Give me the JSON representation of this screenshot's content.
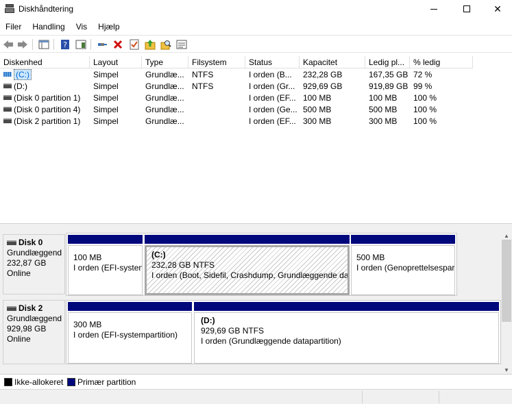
{
  "window": {
    "title": "Diskhåndtering"
  },
  "menu": [
    "Filer",
    "Handling",
    "Vis",
    "Hjælp"
  ],
  "toolbar": [
    "back-icon",
    "forward-icon",
    "console-tree-icon",
    "help-icon",
    "properties-list-icon",
    "connect-icon",
    "delete-icon",
    "checklist-icon",
    "folder-up-icon",
    "folder-search-icon",
    "console-view-icon"
  ],
  "table": {
    "columns": [
      "Diskenhed",
      "Layout",
      "Type",
      "Filsystem",
      "Status",
      "Kapacitet",
      "Ledig pl...",
      "% ledig"
    ],
    "rows": [
      [
        "(C:)",
        "Simpel",
        "Grundlæ...",
        "NTFS",
        "I orden (B...",
        "232,28 GB",
        "167,35 GB",
        "72 %"
      ],
      [
        "(D:)",
        "Simpel",
        "Grundlæ...",
        "NTFS",
        "I orden (Gr...",
        "929,69 GB",
        "919,89 GB",
        "99 %"
      ],
      [
        "(Disk 0 partition 1)",
        "Simpel",
        "Grundlæ...",
        "",
        "I orden (EF...",
        "100 MB",
        "100 MB",
        "100 %"
      ],
      [
        "(Disk 0 partition 4)",
        "Simpel",
        "Grundlæ...",
        "",
        "I orden (Ge...",
        "500 MB",
        "500 MB",
        "100 %"
      ],
      [
        "(Disk 2 partition 1)",
        "Simpel",
        "Grundlæ...",
        "",
        "I orden (EF...",
        "300 MB",
        "300 MB",
        "100 %"
      ]
    ]
  },
  "disks": [
    {
      "name": "Disk 0",
      "type": "Grundlæggend",
      "size": "232,87 GB",
      "status": "Online",
      "partitions": [
        {
          "title": "",
          "size": "100 MB",
          "status": "I orden (EFI-systen"
        },
        {
          "title": "(C:)",
          "size": "232,28 GB NTFS",
          "status": "I orden (Boot, Sidefil, Crashdump, Grundlæggende dat"
        },
        {
          "title": "",
          "size": "500 MB",
          "status": "I orden (Genoprettelsespar"
        }
      ]
    },
    {
      "name": "Disk 2",
      "type": "Grundlæggend",
      "size": "929,98 GB",
      "status": "Online",
      "partitions": [
        {
          "title": "",
          "size": "300 MB",
          "status": "I orden (EFI-systempartition)"
        },
        {
          "title": "(D:)",
          "size": "929,69 GB NTFS",
          "status": "I orden (Grundlæggende datapartition)"
        }
      ]
    }
  ],
  "legend": [
    {
      "label": "Ikke-allokeret",
      "color": "#000000"
    },
    {
      "label": "Primær partition",
      "color": "#00087c"
    }
  ]
}
